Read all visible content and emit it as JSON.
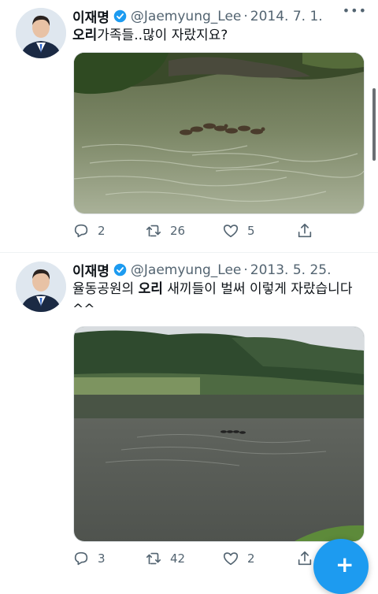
{
  "tweet1": {
    "display_name": "이재명",
    "handle": "@Jaemyung_Lee",
    "separator": "·",
    "date": "2014. 7. 1.",
    "text_bold": "오리",
    "text_rest": "가족들..많이 자랐지요?",
    "reply_count": "2",
    "retweet_count": "26",
    "like_count": "5"
  },
  "tweet2": {
    "display_name": "이재명",
    "handle": "@Jaemyung_Lee",
    "separator": "·",
    "date": "2013. 5. 25.",
    "text_before": "율동공원의 ",
    "text_bold": "오리",
    "text_after": " 새끼들이 벌써 이렇게 자랐습니다",
    "text_line2": "^^",
    "reply_count": "3",
    "retweet_count": "42",
    "like_count": "2"
  },
  "icons": {
    "verified": "verified-badge-icon",
    "more": "more-icon",
    "reply": "reply-icon",
    "retweet": "retweet-icon",
    "like": "heart-icon",
    "share": "share-icon",
    "compose": "compose-icon"
  },
  "colors": {
    "accent": "#1d9bf0",
    "secondary_text": "#536471"
  }
}
